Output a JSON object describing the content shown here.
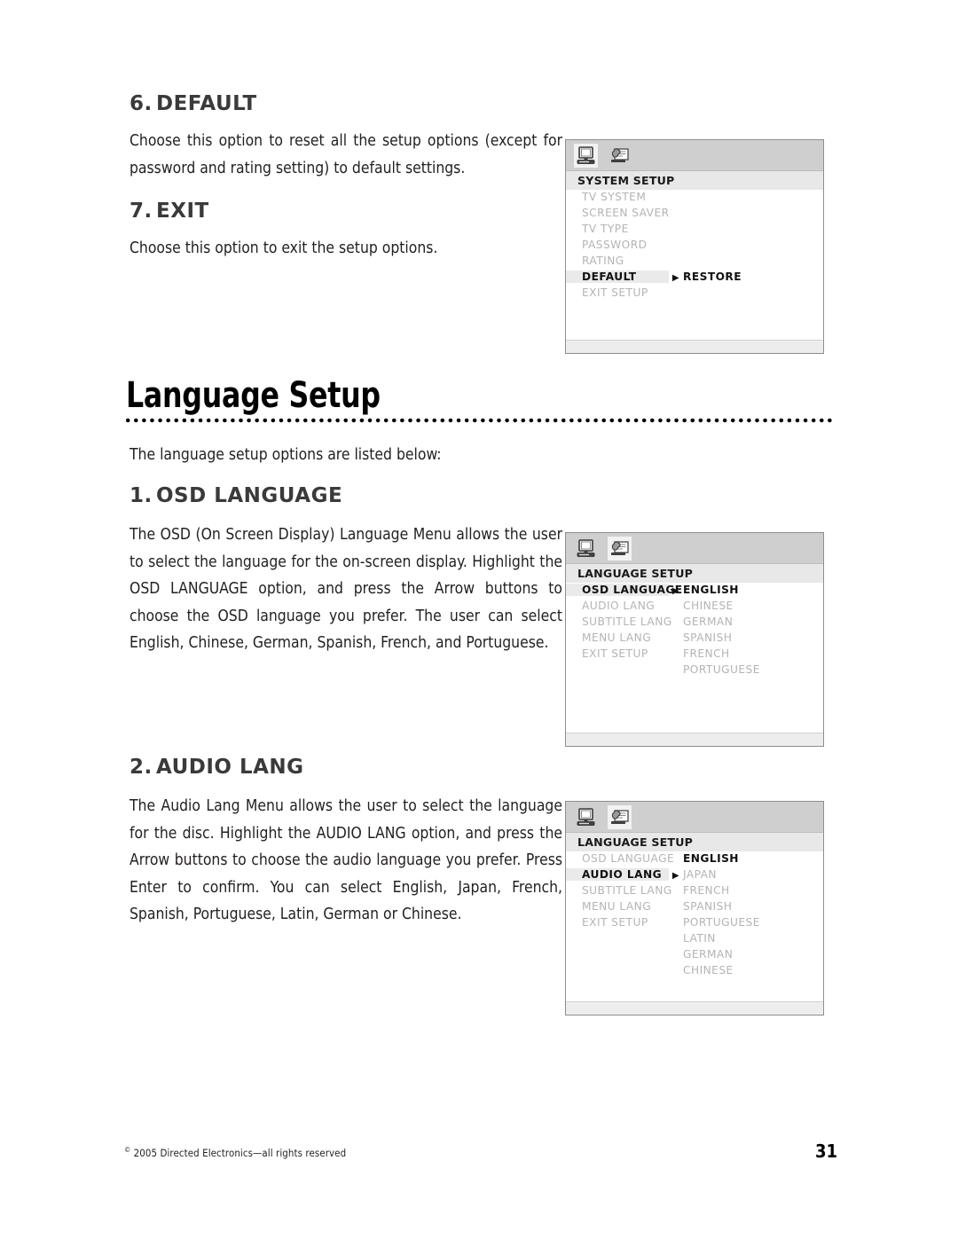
{
  "sections": [
    {
      "number": "6.",
      "title": "DEFAULT",
      "body": "Choose this option to reset all the setup options (except for password and rating setting) to default settings."
    },
    {
      "number": "7.",
      "title": "EXIT",
      "body": "Choose this option to exit the setup options."
    },
    {
      "number": "1.",
      "title": "OSD LANGUAGE",
      "body": "The OSD (On Screen Display) Language Menu allows the user to select the language for the on-screen display. Highlight the OSD LANGUAGE option, and press the Arrow buttons to choose the OSD language you prefer. The user can select English, Chinese, German, Spanish, French, and Portuguese."
    },
    {
      "number": "2.",
      "title": "AUDIO LANG",
      "body": "The Audio Lang Menu allows the user to select the language for the disc. Highlight the AUDIO LANG option, and press the Arrow buttons to choose the audio language you prefer. Press Enter to confirm. You can select English, Japan, French, Spanish, Portuguese, Latin, German or Chinese."
    }
  ],
  "chapter": {
    "title": "Language Setup",
    "intro": "The language setup options are listed below:"
  },
  "osd_menus": [
    {
      "name": "system-setup-menu",
      "icons": [
        "monitor-icon",
        "language-icon"
      ],
      "selected_icon_index": 0,
      "title": "SYSTEM  SETUP",
      "rows": [
        {
          "left": "TV  SYSTEM",
          "highlight": false,
          "arrow": false,
          "right": "",
          "right_on": false
        },
        {
          "left": "SCREEN  SAVER",
          "highlight": false,
          "arrow": false,
          "right": "",
          "right_on": false
        },
        {
          "left": "TV  TYPE",
          "highlight": false,
          "arrow": false,
          "right": "",
          "right_on": false
        },
        {
          "left": "PASSWORD",
          "highlight": false,
          "arrow": false,
          "right": "",
          "right_on": false
        },
        {
          "left": "RATING",
          "highlight": false,
          "arrow": false,
          "right": "",
          "right_on": false
        },
        {
          "left": "DEFAULT",
          "highlight": true,
          "arrow": true,
          "right": "RESTORE",
          "right_on": true
        },
        {
          "left": "EXIT  SETUP",
          "highlight": false,
          "arrow": false,
          "right": "",
          "right_on": false
        }
      ],
      "extra_rows": []
    },
    {
      "name": "osd-language-menu",
      "icons": [
        "monitor-icon",
        "language-icon"
      ],
      "selected_icon_index": 1,
      "title": "LANGUAGE  SETUP",
      "rows": [
        {
          "left": "OSD  LANGUAGE",
          "highlight": true,
          "arrow": true,
          "right": "ENGLISH",
          "right_on": true
        },
        {
          "left": "AUDIO  LANG",
          "highlight": false,
          "arrow": false,
          "right": "CHINESE",
          "right_on": false
        },
        {
          "left": "SUBTITLE LANG",
          "highlight": false,
          "arrow": false,
          "right": "GERMAN",
          "right_on": false
        },
        {
          "left": "MENU  LANG",
          "highlight": false,
          "arrow": false,
          "right": "SPANISH",
          "right_on": false
        },
        {
          "left": "EXIT  SETUP",
          "highlight": false,
          "arrow": false,
          "right": "FRENCH",
          "right_on": false
        },
        {
          "left": "",
          "highlight": false,
          "arrow": false,
          "right": "PORTUGUESE",
          "right_on": false
        }
      ],
      "extra_rows": []
    },
    {
      "name": "audio-lang-menu",
      "icons": [
        "monitor-icon",
        "language-icon"
      ],
      "selected_icon_index": 1,
      "title": "LANGUAGE  SETUP",
      "rows": [
        {
          "left": "OSD  LANGUAGE",
          "highlight": false,
          "arrow": false,
          "right": "ENGLISH",
          "right_on": true
        },
        {
          "left": "AUDIO  LANG",
          "highlight": true,
          "arrow": true,
          "right": "JAPAN",
          "right_on": false
        },
        {
          "left": "SUBTITLE LANG",
          "highlight": false,
          "arrow": false,
          "right": "FRENCH",
          "right_on": false
        },
        {
          "left": "MENU  LANG",
          "highlight": false,
          "arrow": false,
          "right": "SPANISH",
          "right_on": false
        },
        {
          "left": "EXIT  SETUP",
          "highlight": false,
          "arrow": false,
          "right": "PORTUGUESE",
          "right_on": false
        },
        {
          "left": "",
          "highlight": false,
          "arrow": false,
          "right": "LATIN",
          "right_on": false
        },
        {
          "left": "",
          "highlight": false,
          "arrow": false,
          "right": "GERMAN",
          "right_on": false
        },
        {
          "left": "",
          "highlight": false,
          "arrow": false,
          "right": "CHINESE",
          "right_on": false
        }
      ],
      "extra_rows": []
    }
  ],
  "footer": {
    "copyright_symbol": "©",
    "copyright": " 2005 Directed Electronics—all rights reserved",
    "page_number": "31"
  },
  "arrow_glyph": "▶"
}
